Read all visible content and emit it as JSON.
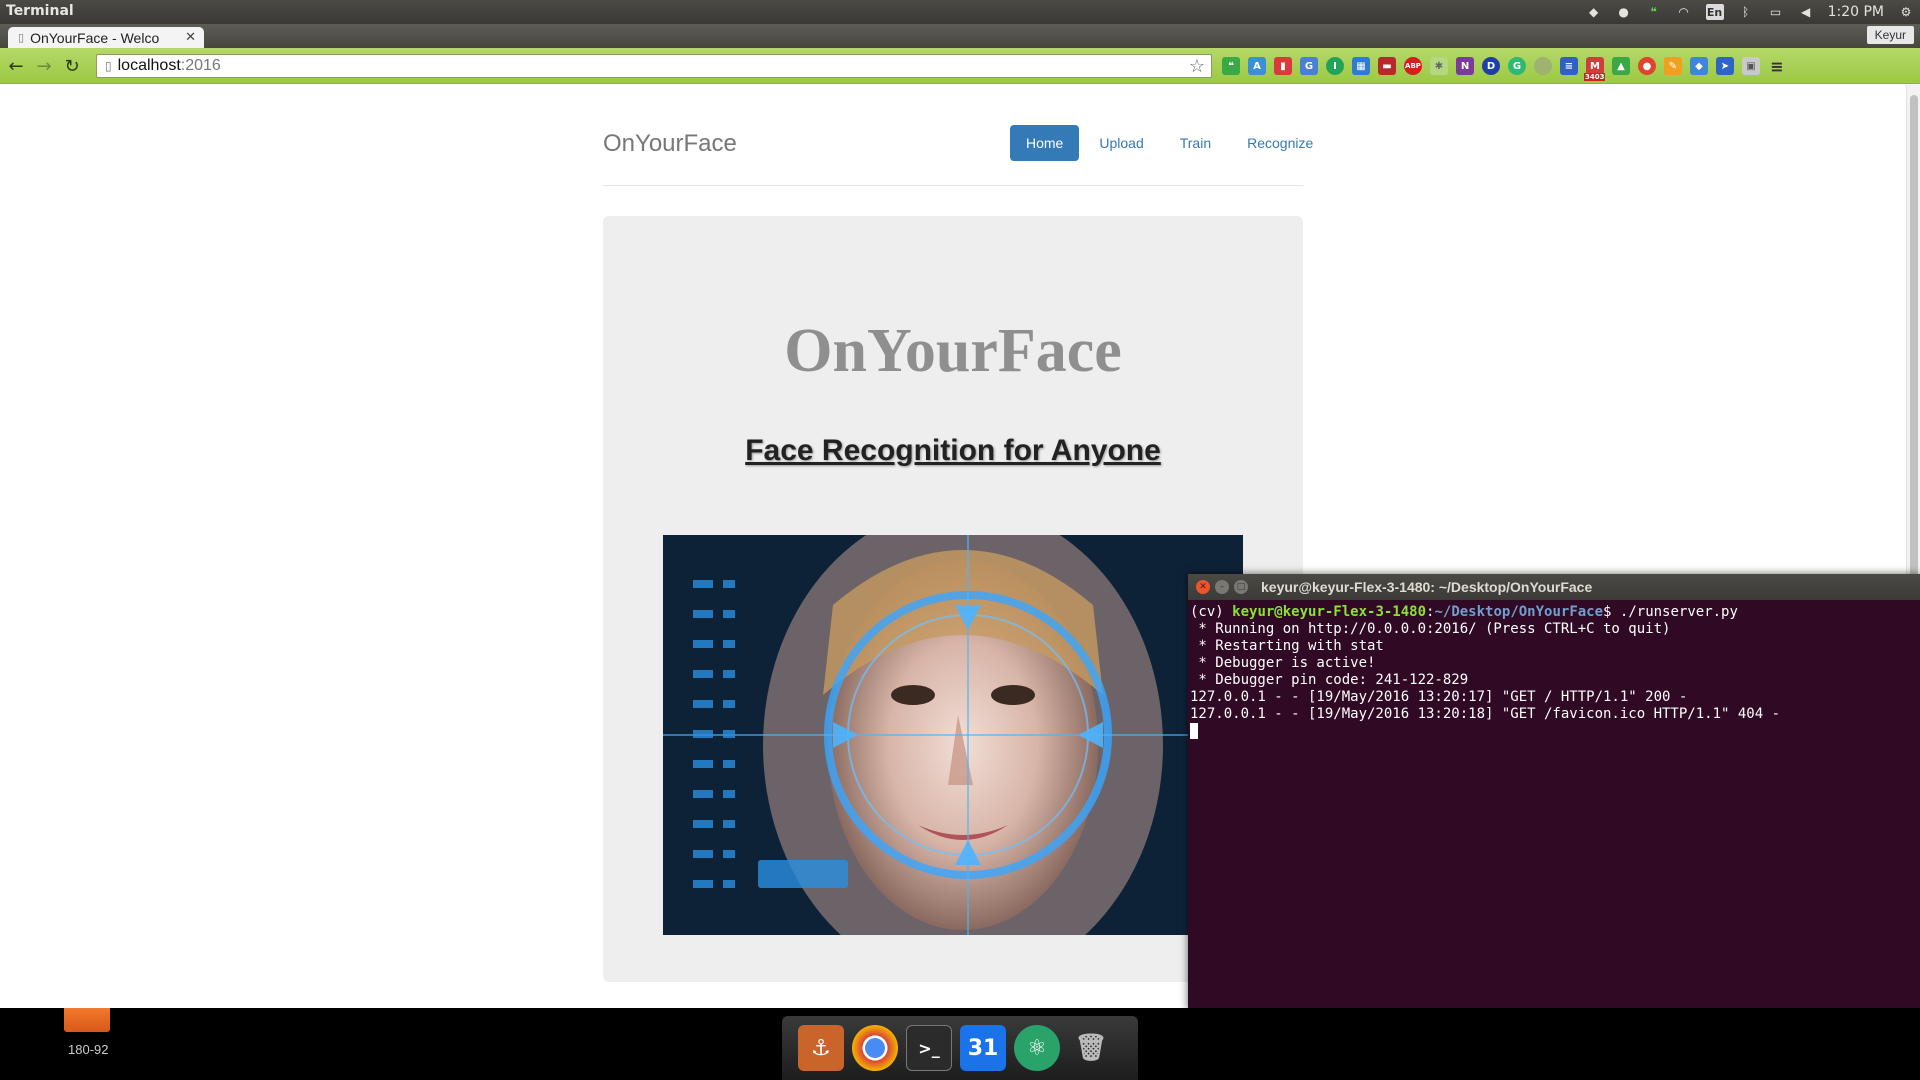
{
  "top_panel": {
    "app_title": "Terminal",
    "clock": "1:20 PM",
    "keyboard_layout": "En"
  },
  "browser": {
    "tab_title": "OnYourFace - Welco",
    "tab_close": "✕",
    "profile_name": "Keyur",
    "url_host": "localhost",
    "url_port": ":2016",
    "extension_badge": "3403"
  },
  "site": {
    "brand": "OnYourFace",
    "nav": [
      {
        "label": "Home",
        "active": true
      },
      {
        "label": "Upload",
        "active": false
      },
      {
        "label": "Train",
        "active": false
      },
      {
        "label": "Recognize",
        "active": false
      }
    ],
    "jumbotron": {
      "heading": "OnYourFace",
      "subheading": "Face Recognition for Anyone"
    }
  },
  "terminal": {
    "window_title": "keyur@keyur-Flex-3-1480: ~/Desktop/OnYourFace",
    "prompt_prefix": "(cv) ",
    "prompt_user": "keyur@keyur-Flex-3-1480",
    "prompt_sep": ":",
    "prompt_path": "~/Desktop/OnYourFace",
    "prompt_command": "$ ./runserver.py",
    "output": [
      " * Running on http://0.0.0.0:2016/ (Press CTRL+C to quit)",
      " * Restarting with stat",
      " * Debugger is active!",
      " * Debugger pin code: 241-122-829",
      "127.0.0.1 - - [19/May/2016 13:20:17] \"GET / HTTP/1.1\" 200 -",
      "127.0.0.1 - - [19/May/2016 13:20:18] \"GET /favicon.ico HTTP/1.1\" 404 -"
    ]
  },
  "taskbar": {
    "workspace_label": "180-92",
    "calendar_day": "31"
  },
  "colors": {
    "bootstrap_primary": "#337ab7",
    "terminal_bg": "#300a24",
    "chrome_theme": "#a6cf4f"
  }
}
